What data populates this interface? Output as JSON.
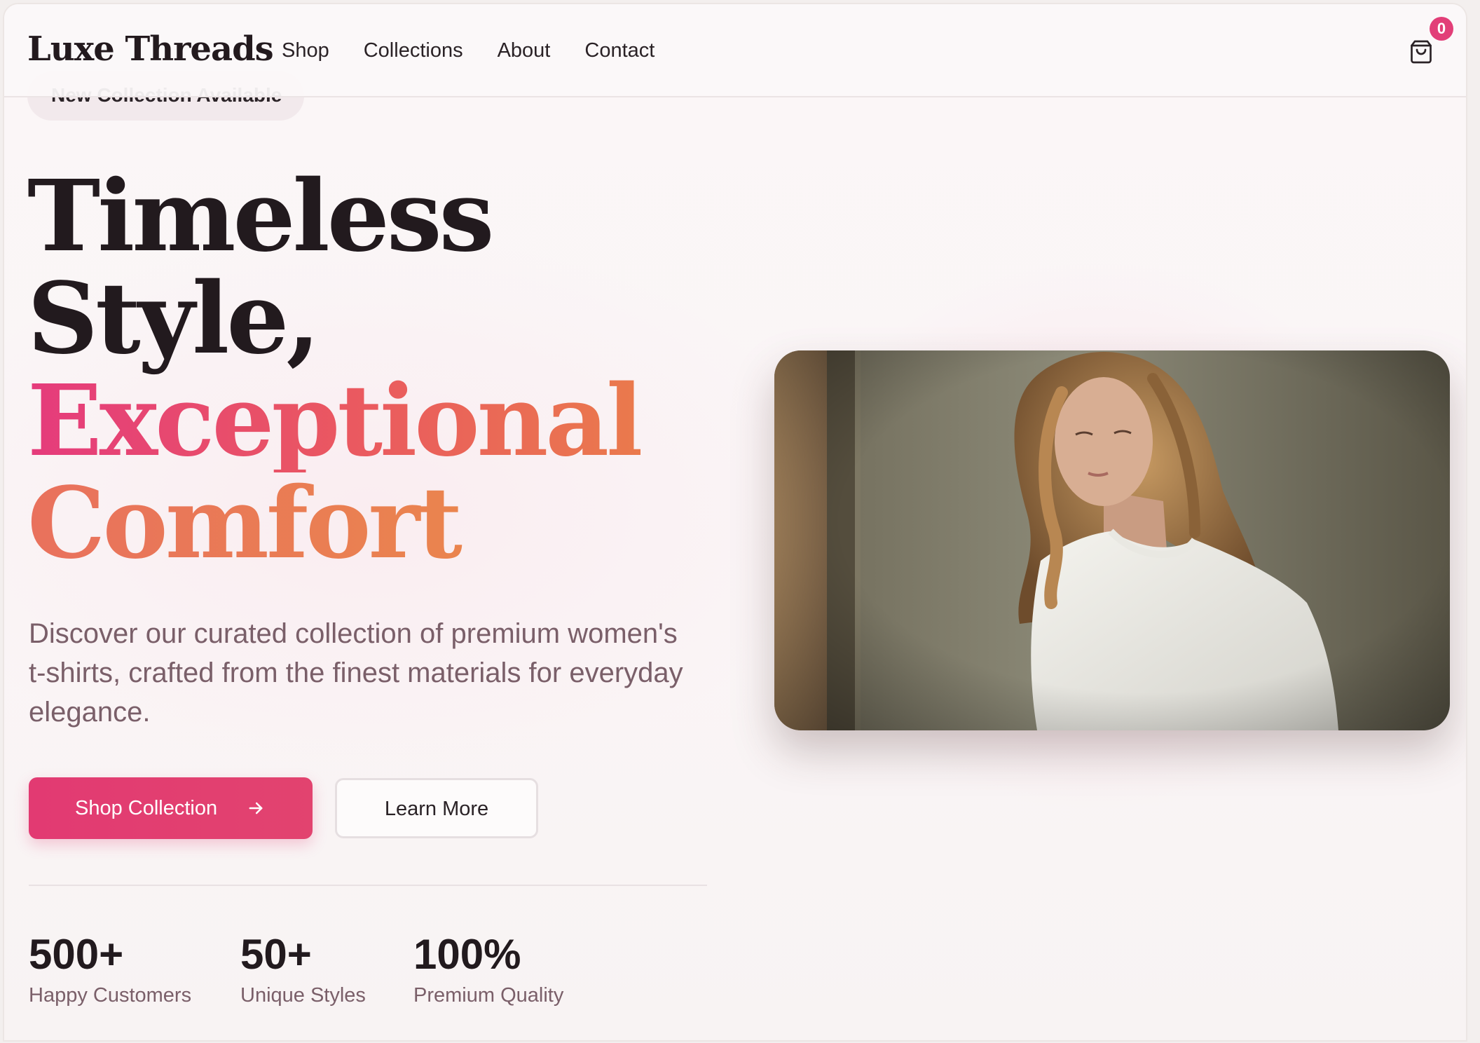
{
  "header": {
    "brand": "Luxe Threads",
    "nav": [
      "Shop",
      "Collections",
      "About",
      "Contact"
    ],
    "cart_count": "0",
    "cart_icon": "shopping-bag-icon"
  },
  "hero": {
    "badge": "New Collection Available",
    "title_line1": "Timeless",
    "title_line2": "Style,",
    "title_line3": "Exceptional",
    "title_line4": "Comfort",
    "description": "Discover our curated collection of premium women's t-shirts, crafted from the finest materials for everyday elegance.",
    "primary_button": "Shop Collection",
    "secondary_button": "Learn More",
    "primary_button_icon": "arrow-right-icon"
  },
  "stats": [
    {
      "value": "500+",
      "label": "Happy Customers"
    },
    {
      "value": "50+",
      "label": "Unique Styles"
    },
    {
      "value": "100%",
      "label": "Premium Quality"
    }
  ],
  "colors": {
    "accent": "#e23a72",
    "heading": "#221a1e",
    "muted_text": "#7a5f69",
    "gradient_start": "#e53b7c",
    "gradient_end": "#ea8c48"
  }
}
